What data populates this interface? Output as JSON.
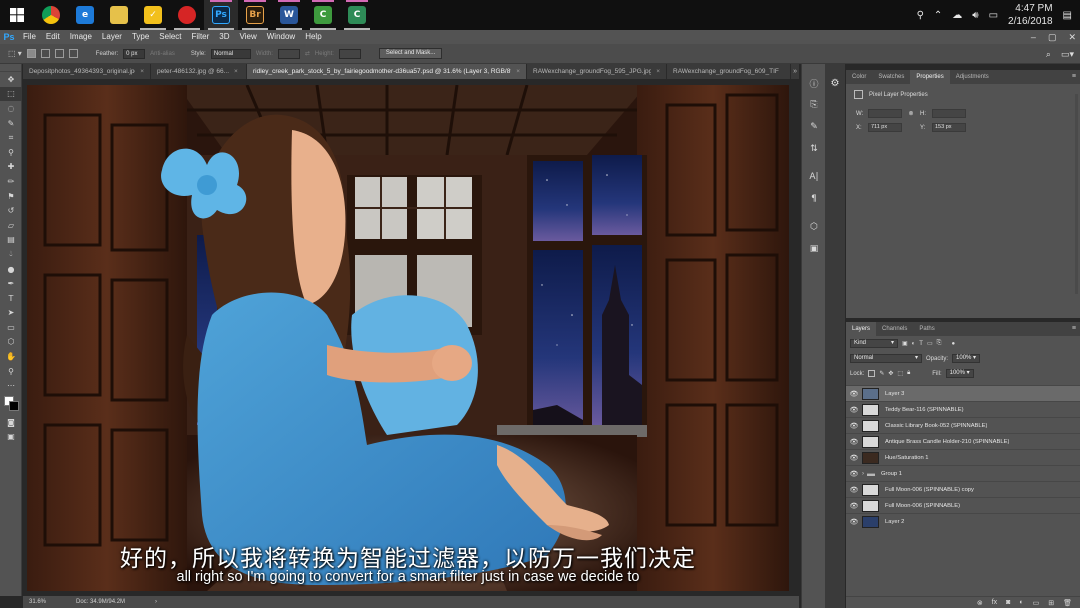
{
  "taskbar": {
    "apps": [
      {
        "name": "chrome",
        "label": "",
        "color": "#e0392b"
      },
      {
        "name": "edge",
        "label": "e",
        "color": "#1d7ad8"
      },
      {
        "name": "file-explorer",
        "label": "",
        "color": "#e6c14a"
      },
      {
        "name": "norton",
        "label": "✓",
        "color": "#f2c01c"
      },
      {
        "name": "screen-recorder",
        "label": "",
        "color": "#d62525"
      },
      {
        "name": "photoshop",
        "label": "Ps",
        "color": "#0b2a4a"
      },
      {
        "name": "bridge",
        "label": "Br",
        "color": "#2b1d0b"
      },
      {
        "name": "word",
        "label": "W",
        "color": "#2a5699"
      },
      {
        "name": "camtasia-1",
        "label": "C",
        "color": "#3e9a3e"
      },
      {
        "name": "camtasia-2",
        "label": "C",
        "color": "#2e8b57"
      }
    ],
    "time": "4:47 PM",
    "date": "2/16/2018"
  },
  "menu": {
    "logo": "Ps",
    "items": [
      "File",
      "Edit",
      "Image",
      "Layer",
      "Type",
      "Select",
      "Filter",
      "3D",
      "View",
      "Window",
      "Help"
    ]
  },
  "options": {
    "feather_label": "Feather:",
    "feather_value": "0 px",
    "antialias_label": "Anti-alias",
    "style_label": "Style:",
    "style_value": "Normal",
    "width_label": "Width:",
    "height_label": "Height:",
    "select_mask": "Select and Mask..."
  },
  "doc_tabs": [
    {
      "label": "Depositphotos_49364393_original.jpg",
      "active": false
    },
    {
      "label": "peter-486132.jpg @ 66...",
      "active": false
    },
    {
      "label": "ridley_creek_park_stock_5_by_fairiegoodmother-d36ua57.psd @ 31.6% (Layer 3, RGB/8*) *",
      "active": true
    },
    {
      "label": "RAWexchange_groundFog_595_JPG.jpg",
      "active": false
    },
    {
      "label": "RAWexchange_groundFog_609_TIF",
      "active": false
    }
  ],
  "status": {
    "zoom": "31.6%",
    "doc": "Doc: 34.9M/94.2M"
  },
  "subtitles": {
    "zh": "好的，所以我将转换为智能过滤器，以防万一我们决定",
    "en": "all right so I'm going to convert for a smart filter just in case we decide to"
  },
  "props_panel": {
    "tabs": [
      "Color",
      "Swatches",
      "Properties",
      "Adjustments"
    ],
    "active": "Properties",
    "title": "Pixel Layer Properties",
    "w_label": "W:",
    "h_label": "H:",
    "x_label": "X:",
    "x_value": "711 px",
    "y_label": "Y:",
    "y_value": "153 px"
  },
  "layers_panel": {
    "tabs": [
      "Layers",
      "Channels",
      "Paths"
    ],
    "active": "Layers",
    "kind": "Kind",
    "blend": "Normal",
    "opacity_label": "Opacity:",
    "opacity": "100%",
    "lock_label": "Lock:",
    "fill_label": "Fill:",
    "fill": "100%",
    "layers": [
      {
        "name": "Layer 3",
        "selected": true,
        "thumb": "#5b6f8a"
      },
      {
        "name": "Teddy Bear-116 (SPINNABLE)",
        "selected": false,
        "thumb": "#d8d8d8"
      },
      {
        "name": "Classic Library Book-052 (SPINNABLE)",
        "selected": false,
        "thumb": "#d8d8d8"
      },
      {
        "name": "Antique Brass Candle Holder-210 (SPINNABLE)",
        "selected": false,
        "thumb": "#d8d8d8"
      },
      {
        "name": "Hue/Saturation 1",
        "selected": false,
        "thumb": "#3b2a20"
      },
      {
        "name": "Group 1",
        "selected": false,
        "thumb": "folder"
      },
      {
        "name": "Full Moon-006 (SPINNABLE) copy",
        "selected": false,
        "thumb": "#d8d8d8"
      },
      {
        "name": "Full Moon-006 (SPINNABLE)",
        "selected": false,
        "thumb": "#d8d8d8"
      },
      {
        "name": "Layer 2",
        "selected": false,
        "thumb": "#2b3f6a"
      }
    ]
  }
}
